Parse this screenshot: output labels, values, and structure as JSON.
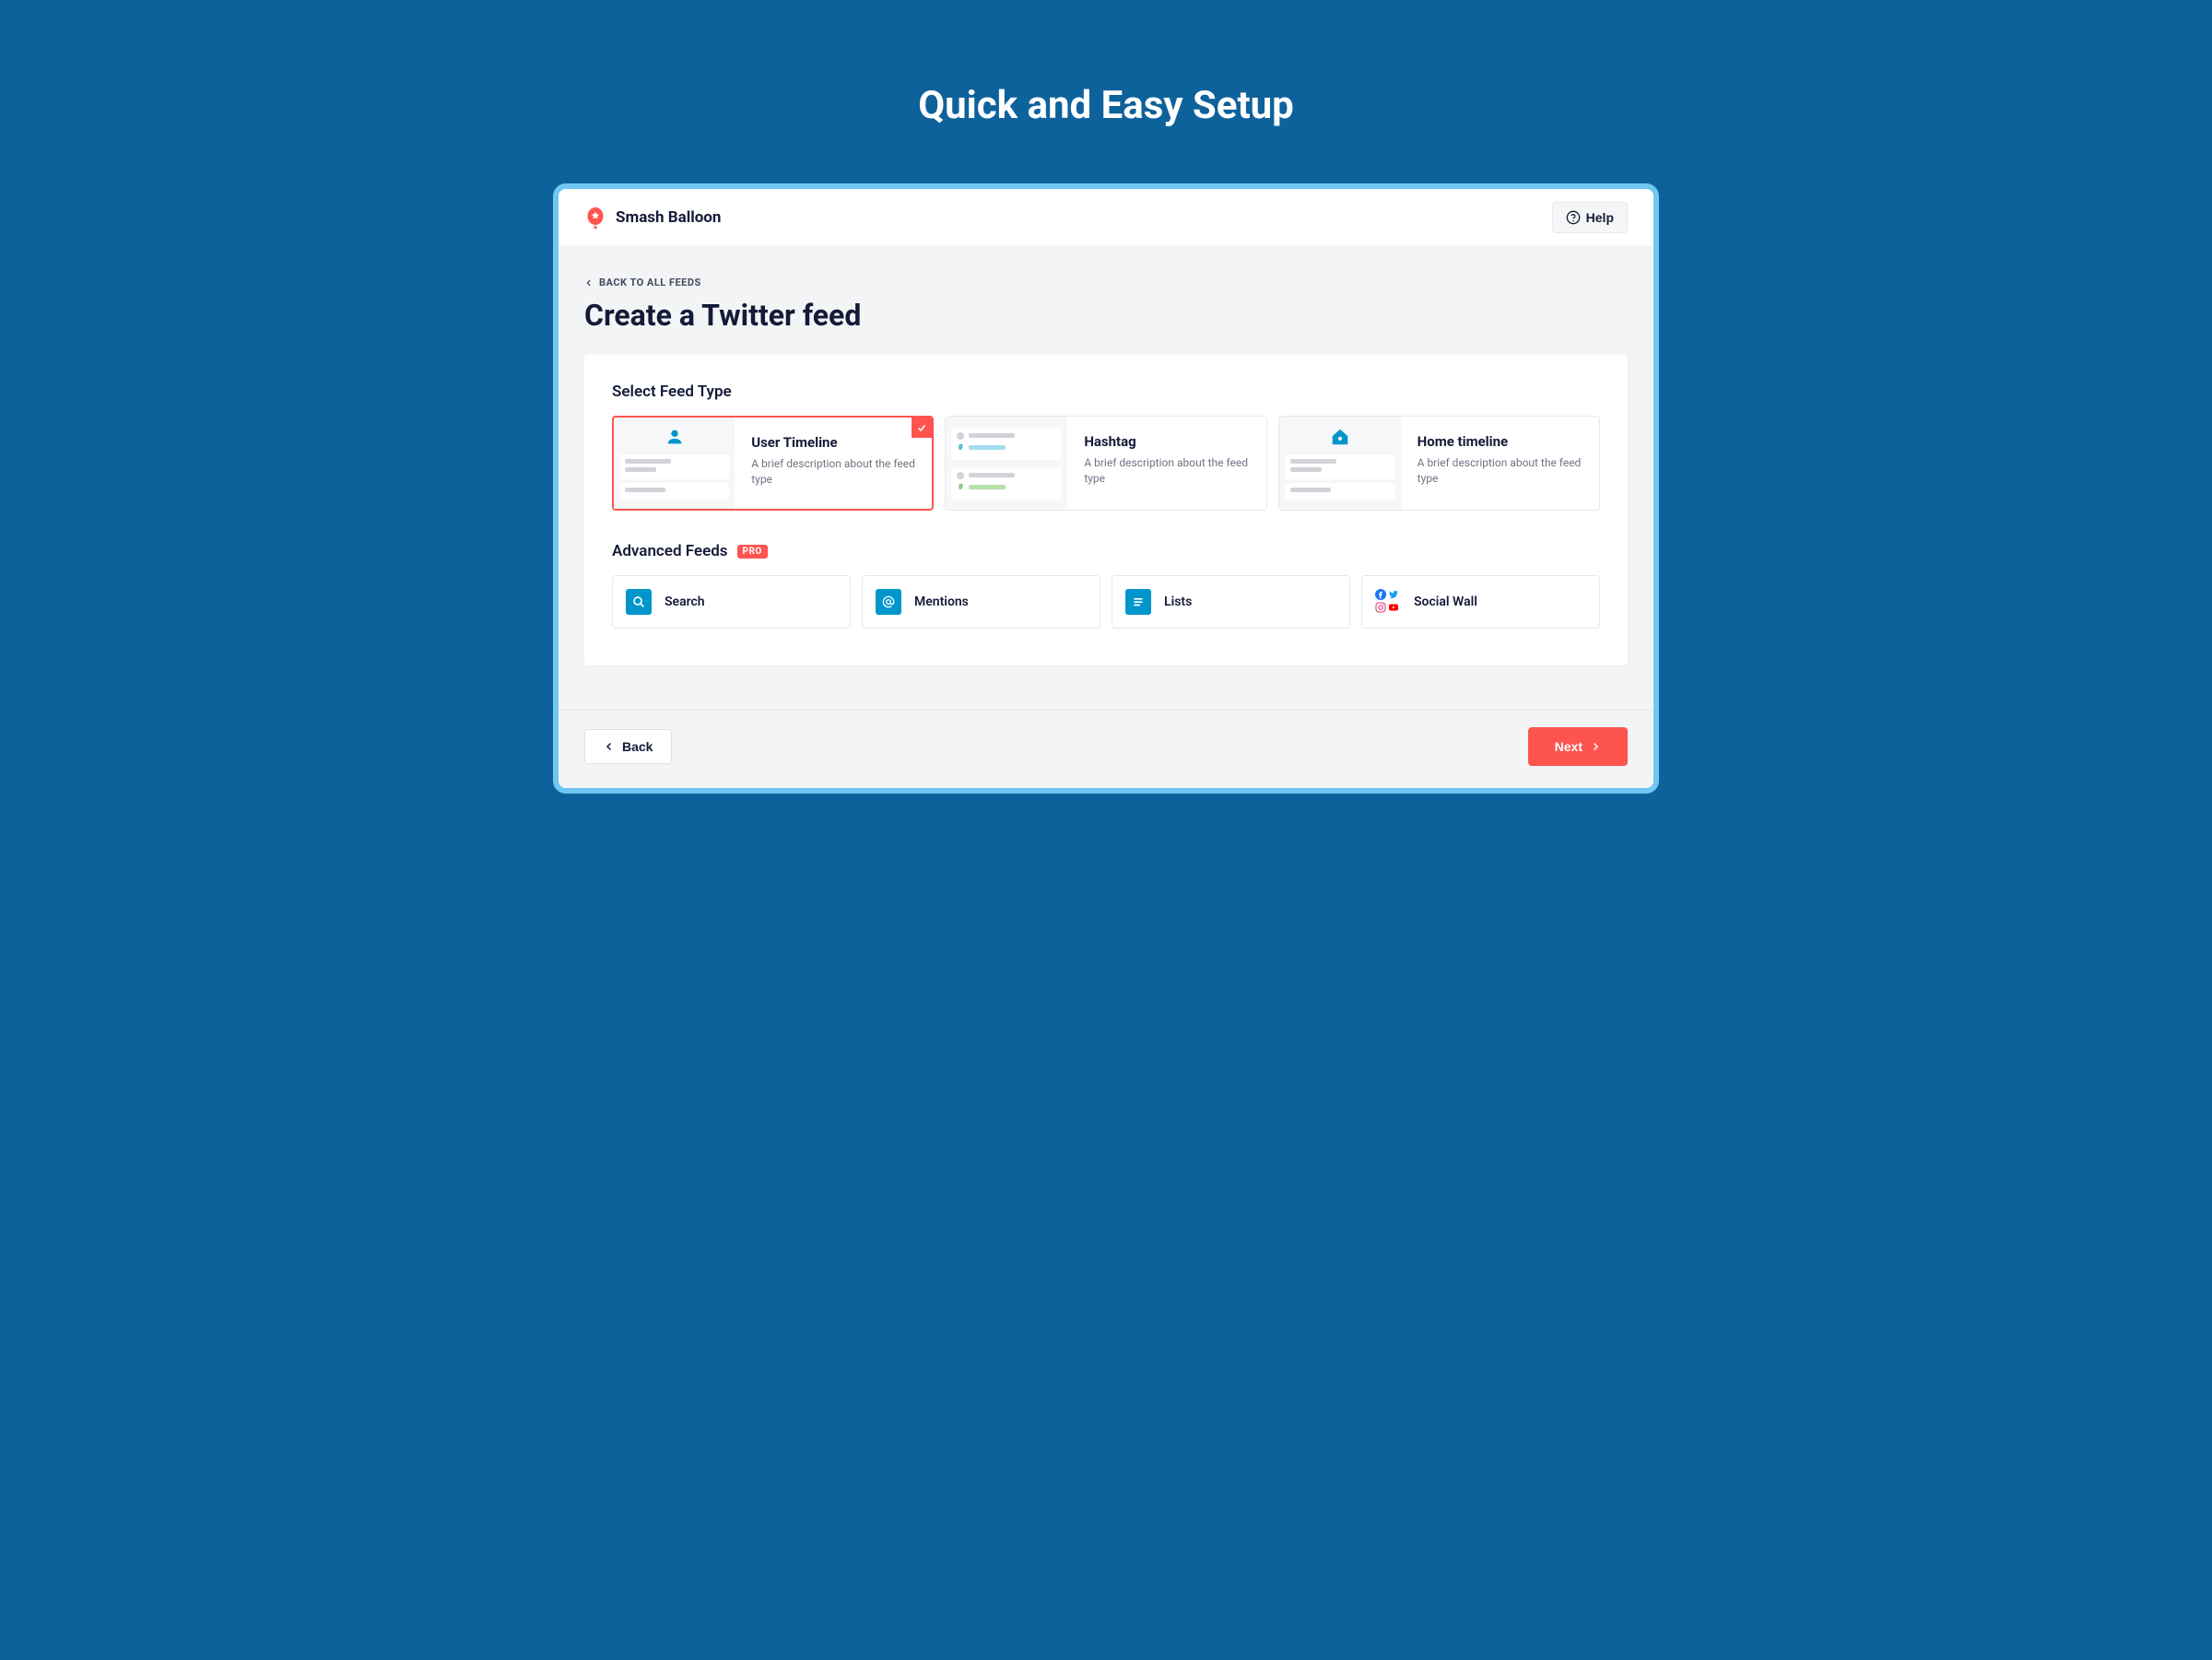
{
  "page_heading": "Quick and Easy Setup",
  "brand_name": "Smash Balloon",
  "help_label": "Help",
  "back_link": "BACK TO ALL FEEDS",
  "title": "Create a Twitter feed",
  "section_feed_type": "Select Feed Type",
  "feed_types": [
    {
      "title": "User Timeline",
      "description": "A brief description about the feed type"
    },
    {
      "title": "Hashtag",
      "description": "A brief description about the feed type"
    },
    {
      "title": "Home timeline",
      "description": "A brief description about the feed type"
    }
  ],
  "section_advanced": "Advanced Feeds",
  "pro_badge": "PRO",
  "advanced": [
    {
      "label": "Search"
    },
    {
      "label": "Mentions"
    },
    {
      "label": "Lists"
    },
    {
      "label": "Social Wall"
    }
  ],
  "footer": {
    "back": "Back",
    "next": "Next"
  }
}
